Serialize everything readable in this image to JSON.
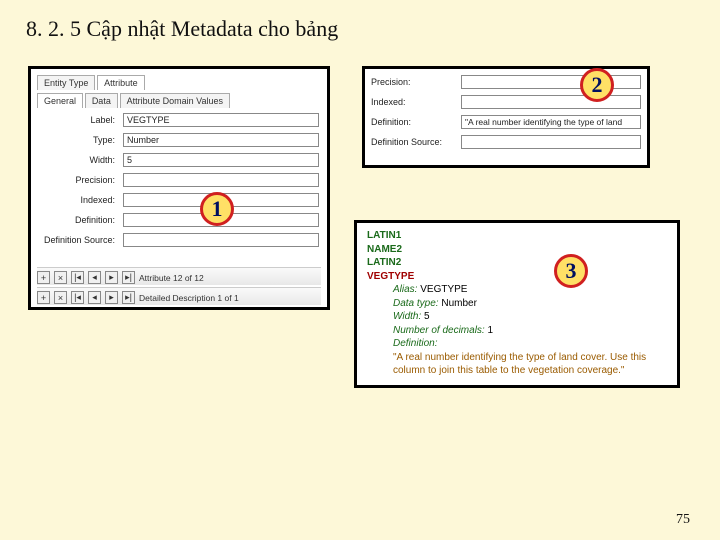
{
  "title": "8. 2. 5 Cập nhật Metadata cho bảng",
  "page_number": "75",
  "badges": {
    "b1": "1",
    "b2": "2",
    "b3": "3"
  },
  "panel1": {
    "tabs_row1": {
      "entity_type": "Entity Type",
      "attribute": "Attribute"
    },
    "tabs_row2": {
      "general": "General",
      "data": "Data",
      "domain": "Attribute Domain Values"
    },
    "labels": {
      "label": "Label:",
      "type": "Type:",
      "width": "Width:",
      "precision": "Precision:",
      "indexed": "Indexed:",
      "definition": "Definition:",
      "defsrc": "Definition Source:"
    },
    "values": {
      "label": "VEGTYPE",
      "type": "Number",
      "width": "5",
      "precision": "",
      "indexed": "",
      "definition": "",
      "defsrc": ""
    },
    "nav1_text": "Attribute 12 of 12",
    "nav2_text": "Detailed Description 1 of 1",
    "btn_plus": "+",
    "btn_x": "×",
    "btn_first": "|◂",
    "btn_prev": "◂",
    "btn_next": "▸",
    "btn_last": "▸|"
  },
  "panel2": {
    "labels": {
      "precision": "Precision:",
      "indexed": "Indexed:",
      "definition": "Definition:",
      "defsrc": "Definition Source:"
    },
    "values": {
      "precision": "",
      "indexed": "",
      "definition": "\"A real number identifying the type of land",
      "defsrc": ""
    }
  },
  "panel3": {
    "attrs": {
      "latin1": "LATIN1",
      "name2": "NAME2",
      "latin2": "LATIN2",
      "vegtype": "VEGTYPE"
    },
    "lines": {
      "alias_k": "Alias:",
      "alias_v": "VEGTYPE",
      "dtype_k": "Data type:",
      "dtype_v": "Number",
      "width_k": "Width:",
      "width_v": "5",
      "dec_k": "Number of decimals:",
      "dec_v": "1",
      "def_k": "Definition:",
      "def_v": "\"A real number identifying the type of land cover. Use this column to join this table to the vegetation coverage.\""
    }
  }
}
